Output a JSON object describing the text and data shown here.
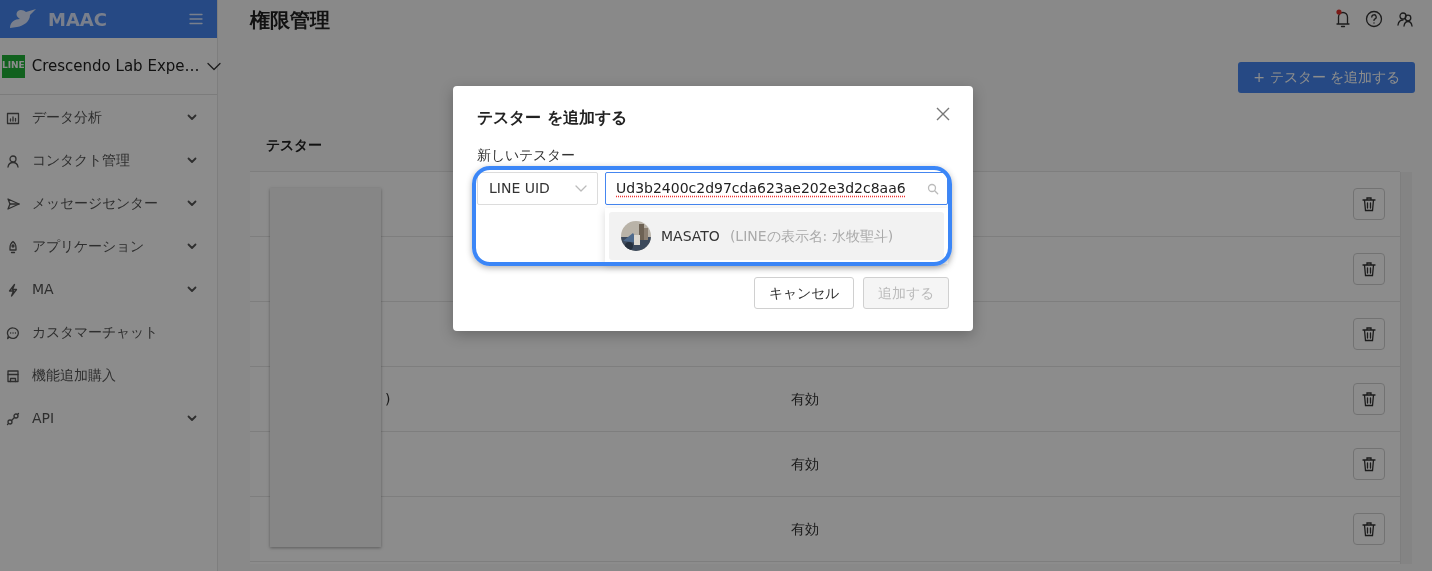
{
  "sidebar": {
    "brand": "MAAC",
    "account": {
      "badge": "LINE",
      "name": "Crescendo Lab Expe…"
    },
    "items": [
      {
        "label": "データ分析",
        "expandable": true
      },
      {
        "label": "コンタクト管理",
        "expandable": true
      },
      {
        "label": "メッセージセンター",
        "expandable": true
      },
      {
        "label": "アプリケーション",
        "expandable": true
      },
      {
        "label": "MA",
        "expandable": true
      },
      {
        "label": "カスタマーチャット",
        "expandable": false
      },
      {
        "label": "機能追加購入",
        "expandable": false
      },
      {
        "label": "API",
        "expandable": true
      }
    ]
  },
  "header": {
    "title": "権限管理",
    "has_unread": true
  },
  "add_button": "+ テスター を追加する",
  "table": {
    "columns": [
      {
        "label": "テスター"
      }
    ],
    "redacted": true,
    "rows": [
      {
        "kind": "covered"
      },
      {
        "kind": "covered"
      },
      {
        "kind": "covered"
      },
      {
        "kind": "tester",
        "name_tail": ")",
        "status": "有効"
      },
      {
        "kind": "tester",
        "status": "有効"
      },
      {
        "kind": "tester",
        "status": "有効"
      }
    ]
  },
  "dialog": {
    "title": "テスター を追加する",
    "field_label": "新しいテスター",
    "id_type": "LINE UID",
    "query": "Ud3b2400c2d97cda623ae202e3d2c8aa6",
    "misspelled": true,
    "highlighted": true,
    "suggestions": [
      {
        "name": "MASATO",
        "detail": "(LINEの表示名: 水牧聖斗)",
        "selected": true
      }
    ],
    "buttons": [
      {
        "label": "キャンセル",
        "disabled": false
      },
      {
        "label": "追加する",
        "disabled": true
      }
    ]
  }
}
